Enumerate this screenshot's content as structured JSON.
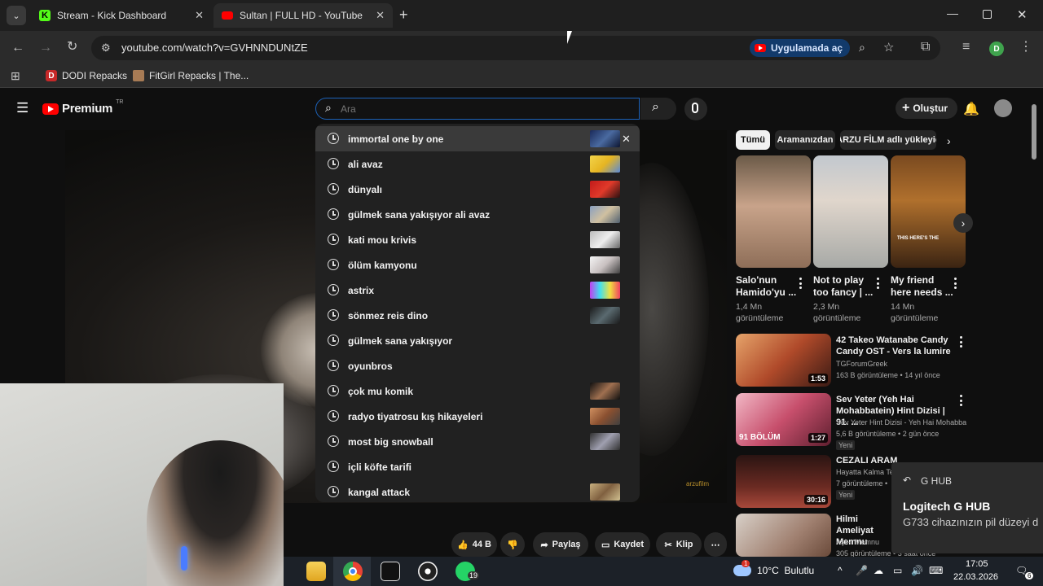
{
  "browser": {
    "tabs": [
      {
        "label": "Stream - Kick Dashboard",
        "active": false
      },
      {
        "label": "Sultan | FULL HD - YouTube",
        "active": true
      }
    ],
    "url": "youtube.com/watch?v=GVHNNDUNtZE",
    "open_in_app": "Uygulamada aç",
    "profile_initial": "D",
    "bookmarks": [
      "DODI Repacks",
      "FitGirl Repacks | The..."
    ]
  },
  "youtube": {
    "logo_text": "Premium",
    "logo_region": "TR",
    "search_placeholder": "Ara",
    "create_label": "Oluştur",
    "suggestions": [
      "immortal one by one",
      "ali avaz",
      "dünyalı",
      "gülmek sana yakışıyor ali avaz",
      "kati mou krivis",
      "ölüm kamyonu",
      "astrix",
      "sönmez reis dino",
      "gülmek sana yakışıyor",
      "oyunbros",
      "çok mu komik",
      "radyo tiyatrosu kış hikayeleri",
      "most big snowball",
      "içli köfte tarifi",
      "kangal attack"
    ],
    "chips": [
      "Tümü",
      "Aramanızdan",
      "ARZU FİLM adlı yükleyic"
    ],
    "shorts": [
      {
        "title": "Salo'nun Hamido'yu ...",
        "views": "1,4 Mn görüntüleme"
      },
      {
        "title": "Not to play too fancy | ...",
        "views": "2,3 Mn görüntüleme"
      },
      {
        "title": "My friend here needs ...",
        "views": "14 Mn görüntüleme"
      }
    ],
    "short_caption": "THIS HERE'S THE",
    "recommendations": [
      {
        "title": "42 Takeo Watanabe Candy Candy OST -  Vers la lumire",
        "channel": "TGForumGreek",
        "meta": "163 B görüntüleme • 14 yıl önce",
        "duration": "1:53",
        "badge": ""
      },
      {
        "title": "Sev Yeter (Yeh Hai Mohabbatein) Hint Dizisi | 91. ...",
        "channel": "Sev Yeter Hint Dizisi - Yeh Hai Mohabbat...",
        "meta": "5,6 B görüntüleme • 2 gün önce",
        "duration": "1:27",
        "badge": "Yeni",
        "thumb_text": "91 BÖLÜM"
      },
      {
        "title": "CEZALI ARAM",
        "channel": "Hayatta Kalma Te",
        "meta": "7 görüntüleme •",
        "duration": "30:16",
        "badge": "Yeni"
      },
      {
        "title": "Hilmi Ameliyat Memnu",
        "channel": "Aşk-ı Memnu",
        "meta": "305 görüntüleme • 3 saat önce",
        "duration": "",
        "badge": ""
      }
    ],
    "actions": {
      "likes": "44 B",
      "share": "Paylaş",
      "save": "Kaydet",
      "clip": "Klip"
    },
    "watermark": "arzufilm"
  },
  "notification": {
    "app": "G HUB",
    "title": "Logitech G HUB",
    "body": "G733 cihazınızın pil düzeyi d"
  },
  "taskbar": {
    "whatsapp_badge": "19",
    "weather": "10°C  Bulutlu",
    "weather_badge": "1",
    "time": "17:05",
    "date": "22.03.2026",
    "notif_count": "6"
  },
  "colors": {
    "accent_blue": "#1c62b9",
    "yt_red": "#ff0000",
    "kick_green": "#53fc18",
    "chrome_dark": "#1f1f1f"
  }
}
